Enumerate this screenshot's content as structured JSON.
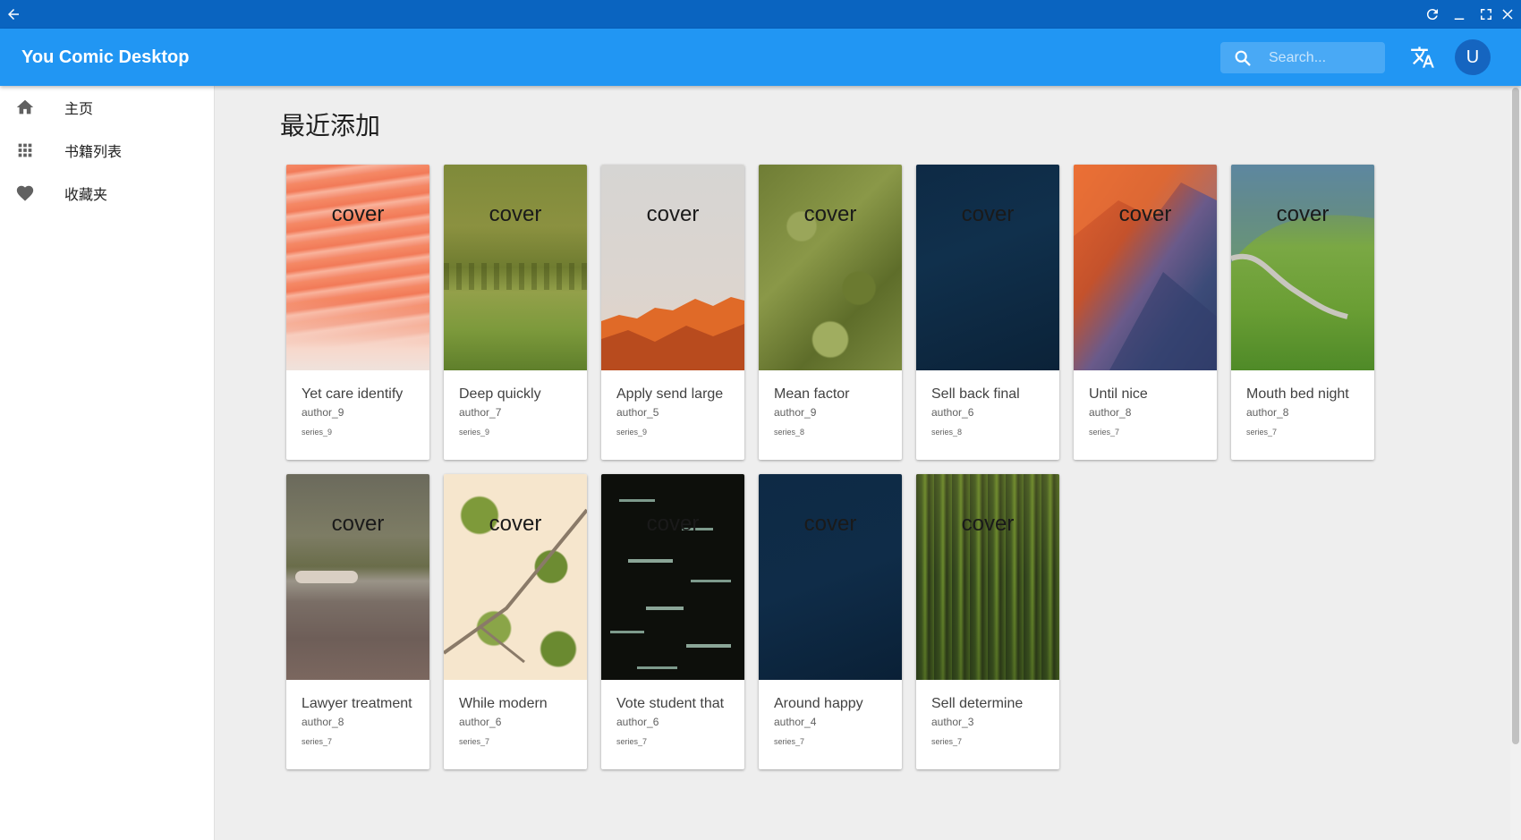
{
  "app": {
    "title": "You Comic Desktop"
  },
  "search": {
    "placeholder": "Search..."
  },
  "user": {
    "avatar_letter": "U"
  },
  "sidebar": {
    "items": [
      {
        "label": "主页",
        "icon": "home-icon"
      },
      {
        "label": "书籍列表",
        "icon": "grid-icon"
      },
      {
        "label": "收藏夹",
        "icon": "heart-icon"
      }
    ]
  },
  "main": {
    "section_title": "最近添加",
    "cover_label": "cover",
    "cards": [
      {
        "title": "Yet care identify",
        "author": "author_9",
        "series": "series_9"
      },
      {
        "title": "Deep quickly",
        "author": "author_7",
        "series": "series_9"
      },
      {
        "title": "Apply send large",
        "author": "author_5",
        "series": "series_9"
      },
      {
        "title": "Mean factor",
        "author": "author_9",
        "series": "series_8"
      },
      {
        "title": "Sell back final",
        "author": "author_6",
        "series": "series_8"
      },
      {
        "title": "Until nice",
        "author": "author_8",
        "series": "series_7"
      },
      {
        "title": "Mouth bed night",
        "author": "author_8",
        "series": "series_7"
      },
      {
        "title": "Lawyer treatment",
        "author": "author_8",
        "series": "series_7"
      },
      {
        "title": "While modern",
        "author": "author_6",
        "series": "series_7"
      },
      {
        "title": "Vote student that",
        "author": "author_6",
        "series": "series_7"
      },
      {
        "title": "Around happy",
        "author": "author_4",
        "series": "series_7"
      },
      {
        "title": "Sell determine",
        "author": "author_3",
        "series": "series_7"
      }
    ]
  },
  "colors": {
    "titlebar": "#0a64c0",
    "appbar": "#2196f3",
    "avatar": "#1565c0",
    "background": "#eeeeee"
  }
}
